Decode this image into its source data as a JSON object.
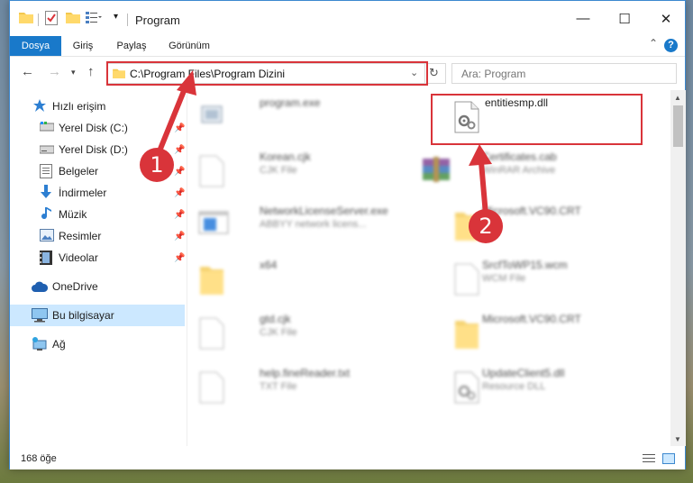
{
  "window": {
    "title": "Program",
    "controls": {
      "minimize": "—",
      "maximize": "☐",
      "close": "✕"
    }
  },
  "ribbon": {
    "tabs": [
      {
        "label": "Dosya",
        "active": true
      },
      {
        "label": "Giriş"
      },
      {
        "label": "Paylaş"
      },
      {
        "label": "Görünüm"
      }
    ],
    "help": "?"
  },
  "address_bar": {
    "path": "C:\\Program Files\\Program Dizini",
    "search_placeholder": "Ara: Program"
  },
  "sidebar": {
    "items": [
      {
        "label": "Hızlı erişim",
        "icon": "star-icon",
        "pinned": false
      },
      {
        "label": "Yerel Disk (C:)",
        "icon": "drive-icon",
        "pinned": true
      },
      {
        "label": "Yerel Disk (D:)",
        "icon": "drive-icon",
        "pinned": true
      },
      {
        "label": "Belgeler",
        "icon": "documents-icon",
        "pinned": true
      },
      {
        "label": "İndirmeler",
        "icon": "download-icon",
        "pinned": true
      },
      {
        "label": "Müzik",
        "icon": "music-icon",
        "pinned": true
      },
      {
        "label": "Resimler",
        "icon": "pictures-icon",
        "pinned": true
      },
      {
        "label": "Videolar",
        "icon": "videos-icon",
        "pinned": true
      },
      {
        "label": "OneDrive",
        "icon": "cloud-icon",
        "pinned": false
      },
      {
        "label": "Bu bilgisayar",
        "icon": "computer-icon",
        "pinned": false,
        "selected": true
      },
      {
        "label": "Ağ",
        "icon": "network-icon",
        "pinned": false
      }
    ]
  },
  "files": [
    {
      "name": "program.exe",
      "type": "",
      "icon": "exe-icon",
      "blurred": true
    },
    {
      "name": "entitiesmp.dll",
      "type": "",
      "icon": "dll-icon",
      "blurred": false,
      "highlighted": true
    },
    {
      "name": "Korean.cjk",
      "type": "CJK File",
      "icon": "file-icon",
      "blurred": true
    },
    {
      "name": "Certificates.cab",
      "type": "WinRAR Archive",
      "icon": "winrar-icon",
      "blurred": true
    },
    {
      "name": "NetworkLicenseServer.exe",
      "type": "ABBYY network licens...",
      "icon": "window-icon",
      "blurred": true
    },
    {
      "name": "Microsoft.VC90.CRT",
      "type": "",
      "icon": "folder-icon",
      "blurred": true
    },
    {
      "name": "x64",
      "type": "",
      "icon": "folder-icon",
      "blurred": true
    },
    {
      "name": "SrcfToWP15.wcm",
      "type": "WCM File",
      "icon": "file-icon",
      "blurred": true
    },
    {
      "name": "gtd.cjk",
      "type": "CJK File",
      "icon": "file-icon",
      "blurred": true
    },
    {
      "name": "Microsoft.VC90.CRT",
      "type": "",
      "icon": "folder-icon",
      "blurred": true
    },
    {
      "name": "help.fineReader.txt",
      "type": "TXT File",
      "icon": "file-icon",
      "blurred": true
    },
    {
      "name": "UpdateClient5.dll",
      "type": "Resource DLL",
      "icon": "dll-icon",
      "blurred": true
    }
  ],
  "status": {
    "item_count": "168 öğe"
  },
  "annotations": {
    "step1": "1",
    "step2": "2"
  },
  "colors": {
    "accent": "#1979ca",
    "annotation": "#d9343a",
    "selected": "#cce8ff"
  }
}
